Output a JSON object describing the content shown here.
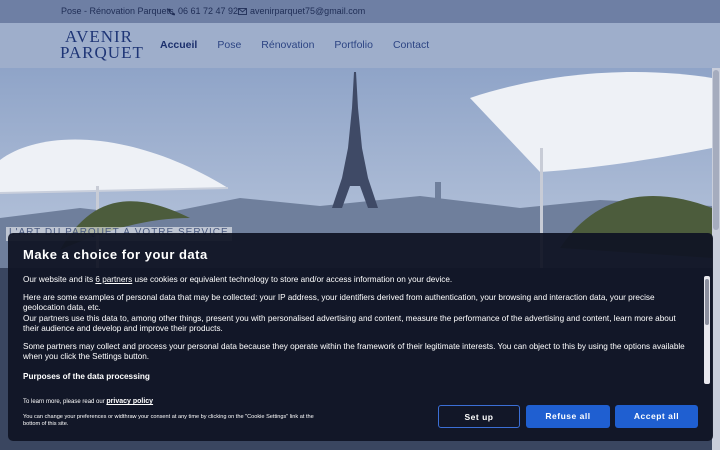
{
  "topbar": {
    "tagline": "Pose - Rénovation Parquets",
    "phone": "06 61 72 47 92",
    "email": "avenirparquet75@gmail.com",
    "phone_icon": "phone-icon",
    "mail_icon": "mail-icon"
  },
  "header": {
    "logo_line1": "AVENIR",
    "logo_line2": "PARQUET",
    "nav": [
      {
        "label": "Accueil",
        "active": true
      },
      {
        "label": "Pose",
        "active": false
      },
      {
        "label": "Rénovation",
        "active": false
      },
      {
        "label": "Portfolio",
        "active": false
      },
      {
        "label": "Contact",
        "active": false
      }
    ]
  },
  "hero": {
    "caption": "L'ART DU PARQUET À VOTRE SERVICE"
  },
  "consent": {
    "title": "Make a choice for your data",
    "p1_before": "Our website and its ",
    "p1_link": "6 partners",
    "p1_after": " use cookies or equivalent technology to store and/or access information on your device.",
    "p2": "Here are some examples of personal data that may be collected: your IP address, your identifiers derived from authentication, your browsing and interaction data, your precise geolocation data, etc.",
    "p3": "Our partners use this data to, among other things, present you with personalised advertising and content, measure the performance of the advertising and content, learn more about their audience and develop and improve their products.",
    "p4": "Some partners may collect and process your personal data because they operate within the framework of their legitimate interests. You can object to this by using the options available when you click the Settings button.",
    "purposes_heading": "Purposes of the data processing",
    "privacy_prefix": "To learn more, please read our ",
    "privacy_link": "privacy policy",
    "change_note": "You can change your preferences or widthraw your consent at any time by clicking on the \"Cookie Settings\" link at the bottom of this site.",
    "setup_label": "Set up",
    "refuse_label": "Refuse all",
    "accept_label": "Accept all"
  },
  "colors": {
    "accent": "#1f5fd1",
    "brand": "#1e3576",
    "overlay": "#10142400"
  }
}
